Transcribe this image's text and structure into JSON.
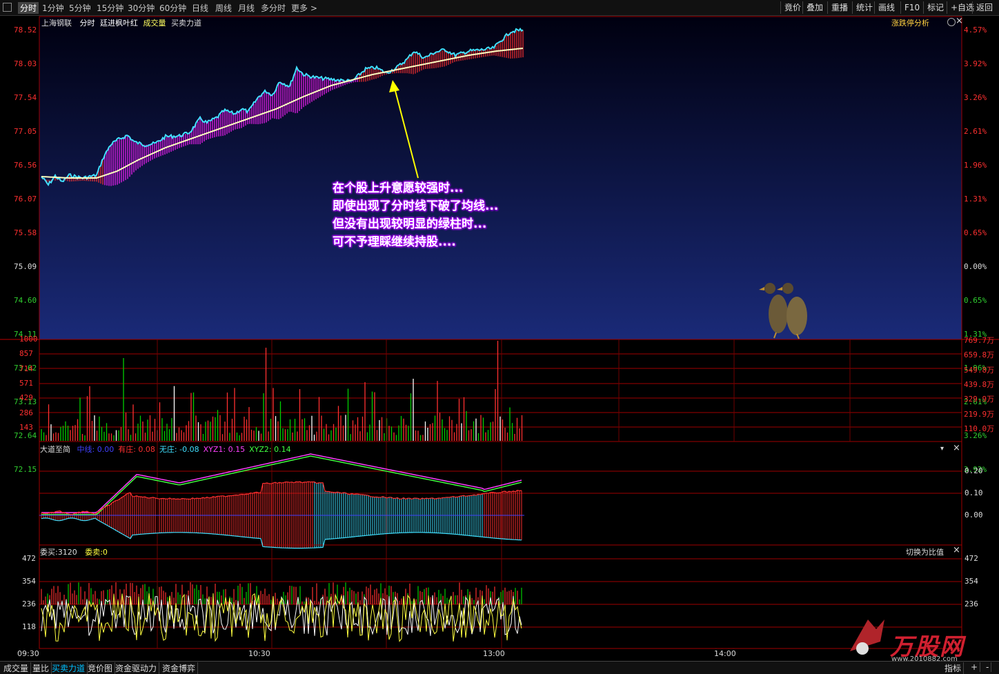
{
  "toolbar": {
    "tabs": [
      "分时",
      "1分钟",
      "5分钟",
      "15分钟",
      "30分钟",
      "60分钟",
      "日线",
      "周线",
      "月线",
      "多分时",
      "更多 >"
    ],
    "right_buttons": [
      "竟价",
      "叠加",
      "重播",
      "统计",
      "画线",
      "F10",
      "标记",
      "+自选",
      "返回"
    ]
  },
  "price_pane": {
    "stock_name": "上海钢联",
    "mode": "分时",
    "indicator_name": "廷进枫叶红",
    "volume_label": "成交量",
    "buysell_label": "买卖力道",
    "analysis_button": "涨跌停分析",
    "left_prices": [
      "78.52",
      "78.03",
      "77.54",
      "77.05",
      "76.56",
      "76.07",
      "75.58",
      "75.09",
      "74.60",
      "74.11",
      "73.62",
      "73.13",
      "72.64",
      "72.15"
    ],
    "right_pcts": [
      "4.57%",
      "3.92%",
      "3.26%",
      "2.61%",
      "1.96%",
      "1.31%",
      "0.65%",
      "0.00%",
      "0.65%",
      "1.31%",
      "1.96%",
      "2.61%",
      "3.26%",
      "3.92%"
    ]
  },
  "annotation": {
    "lines": [
      "在个股上升意愿较强时...",
      "即使出现了分时线下破了均线...",
      "但没有出现较明显的绿柱时...",
      "可不予理睬继续持股...."
    ]
  },
  "volume_pane": {
    "left_labels": [
      "1000",
      "857",
      "714",
      "571",
      "429",
      "286",
      "143"
    ],
    "right_labels": [
      "769.7万",
      "659.8万",
      "549.8万",
      "439.8万",
      "329.9万",
      "219.9万",
      "110.0万"
    ]
  },
  "indicator_pane": {
    "name": "大道至简",
    "items": [
      {
        "label": "中线:",
        "value": "0.00",
        "color": "#4040ff"
      },
      {
        "label": "有庄:",
        "value": "0.08",
        "color": "#ff3030"
      },
      {
        "label": "无庄:",
        "value": "-0.08",
        "color": "#40e0ff"
      },
      {
        "label": "XYZ1:",
        "value": "0.15",
        "color": "#ff40ff"
      },
      {
        "label": "XYZ2:",
        "value": "0.14",
        "color": "#40ff40"
      }
    ],
    "right_labels": [
      "0.20",
      "0.10",
      "0.00"
    ]
  },
  "order_pane": {
    "buy_label": "委买:3120",
    "sell_label": "委卖:0",
    "switch_label": "切换为比值",
    "left_labels": [
      "472",
      "354",
      "236",
      "118"
    ],
    "right_labels": [
      "472",
      "354",
      "236"
    ]
  },
  "time_axis": [
    "09:30",
    "10:30",
    "13:00",
    "14:00"
  ],
  "bottom_tabs": [
    "成交量",
    "量比",
    "买卖力道",
    "竞价图",
    "资金驱动力",
    "资金博弈"
  ],
  "bottom_right": [
    "指标",
    "+",
    "-"
  ],
  "watermark": {
    "brand": "万股网",
    "url": "www.2010882.com"
  },
  "colors": {
    "up": "#ff3030",
    "down": "#00d000",
    "price_line": "#40e0ff",
    "avg_line": "#ffffc0",
    "fill": "#ff20ff",
    "bg_gradient_top": "#000010",
    "bg_gradient_bottom": "#1a2a78"
  }
}
